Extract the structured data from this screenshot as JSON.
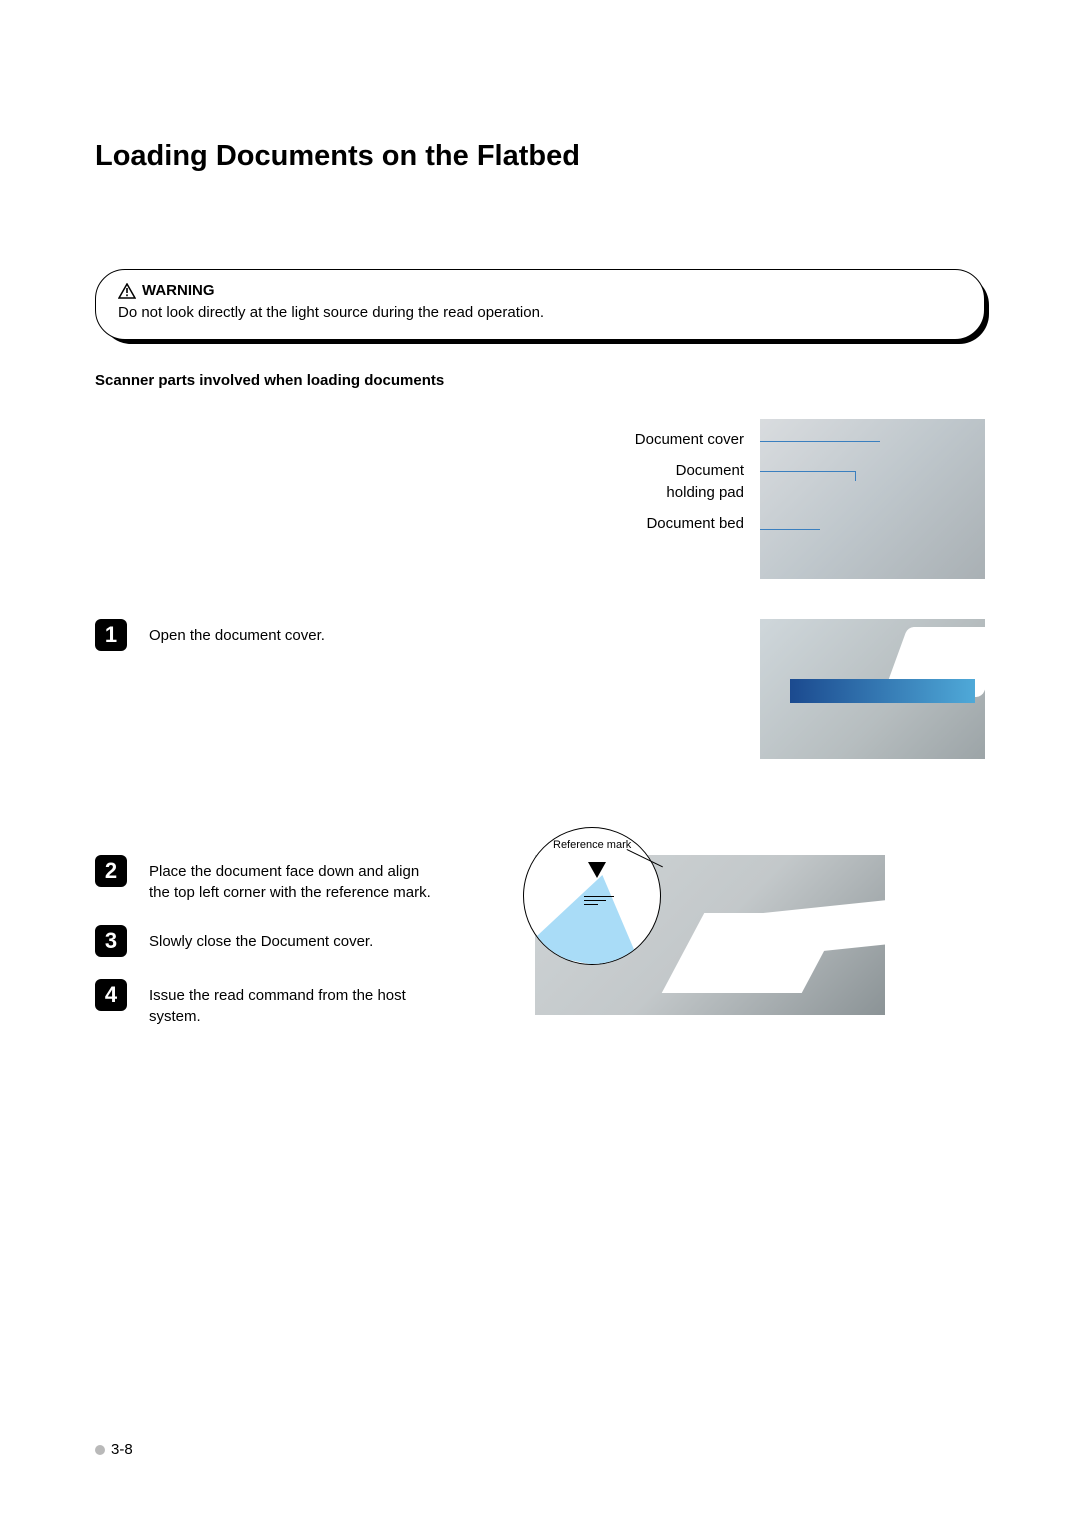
{
  "title": "Loading Documents on the Flatbed",
  "warning": {
    "label": "WARNING",
    "text": "Do not look directly at the light source during the read operation."
  },
  "subhead": "Scanner parts involved when loading documents",
  "parts": {
    "label1": "Document cover",
    "label2a": "Document",
    "label2b": "holding pad",
    "label3": "Document bed"
  },
  "steps": [
    {
      "n": "1",
      "text": "Open the document cover."
    },
    {
      "n": "2",
      "text": "Place the document face down and align the top left corner with the reference mark."
    },
    {
      "n": "3",
      "text": "Slowly close the Document cover."
    },
    {
      "n": "4",
      "text": "Issue the read command from the host system."
    }
  ],
  "reference_mark_label": "Reference mark",
  "page_number": "3-8"
}
